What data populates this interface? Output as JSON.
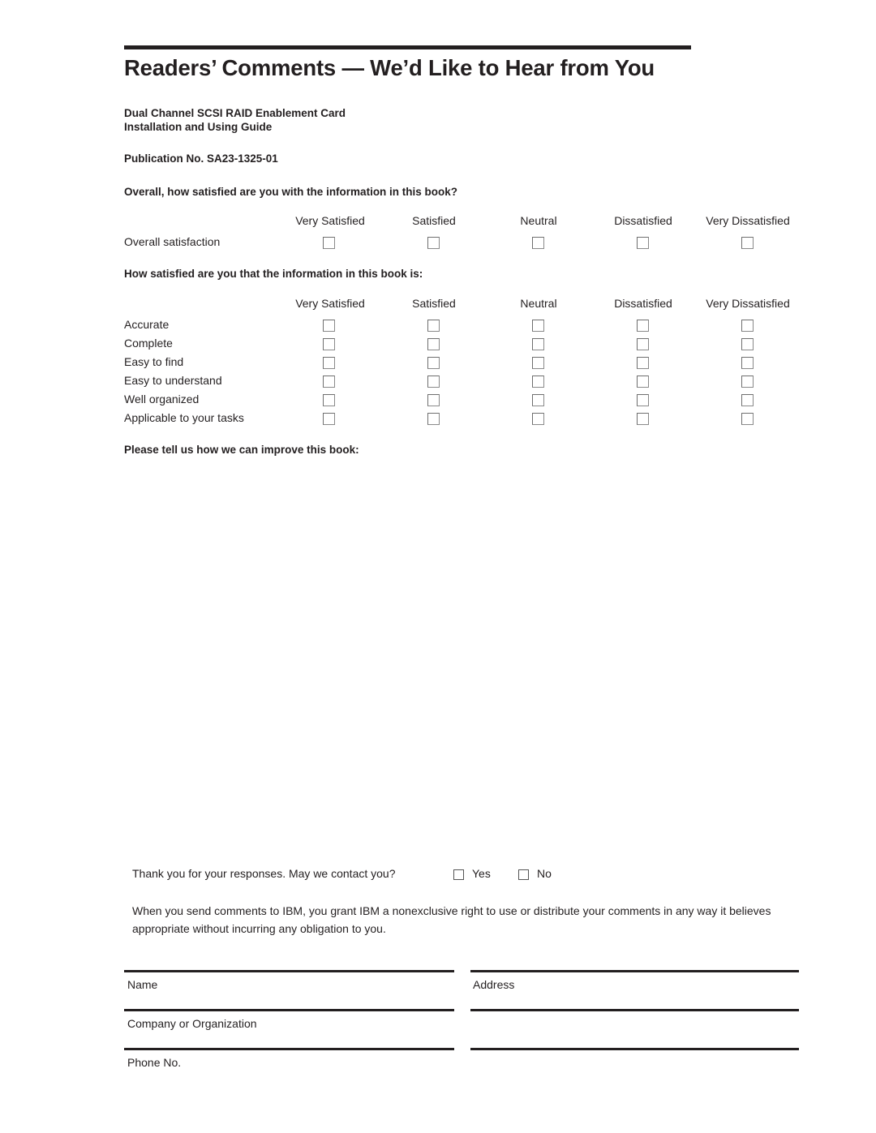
{
  "page": {
    "title": "Readers’ Comments — We’d Like to Hear from You"
  },
  "document_info": {
    "line1": "Dual Channel SCSI RAID Enablement Card",
    "line2": "Installation and Using Guide",
    "publication": "Publication No.  SA23-1325-01"
  },
  "questions": {
    "overall": "Overall, how satisfied are you with the information in this book?",
    "aspects": "How satisfied are you that the information in this book is:",
    "improve": "Please tell us how we can improve this book:"
  },
  "scale": {
    "columns": [
      "Very Satisfied",
      "Satisfied",
      "Neutral",
      "Dissatisfied",
      "Very Dissatisfied"
    ]
  },
  "overall_table": {
    "rows": [
      "Overall satisfaction"
    ]
  },
  "aspects_table": {
    "rows": [
      "Accurate",
      "Complete",
      "Easy to find",
      "Easy to understand",
      "Well organized",
      "Applicable to your tasks"
    ]
  },
  "contact": {
    "prompt": "Thank you for your responses. May we contact you?",
    "yes_label": "Yes",
    "no_label": "No"
  },
  "legal": {
    "text": "When you send comments to IBM, you grant IBM a nonexclusive right to use or distribute your comments in any way it believes appropriate without incurring any obligation to you."
  },
  "form_fields": {
    "name": "Name",
    "address": "Address",
    "company": "Company or Organization",
    "phone": "Phone No."
  },
  "colors": {
    "ink": "#231f20",
    "checkbox_border": "#8a8a8a",
    "paper": "#ffffff"
  }
}
